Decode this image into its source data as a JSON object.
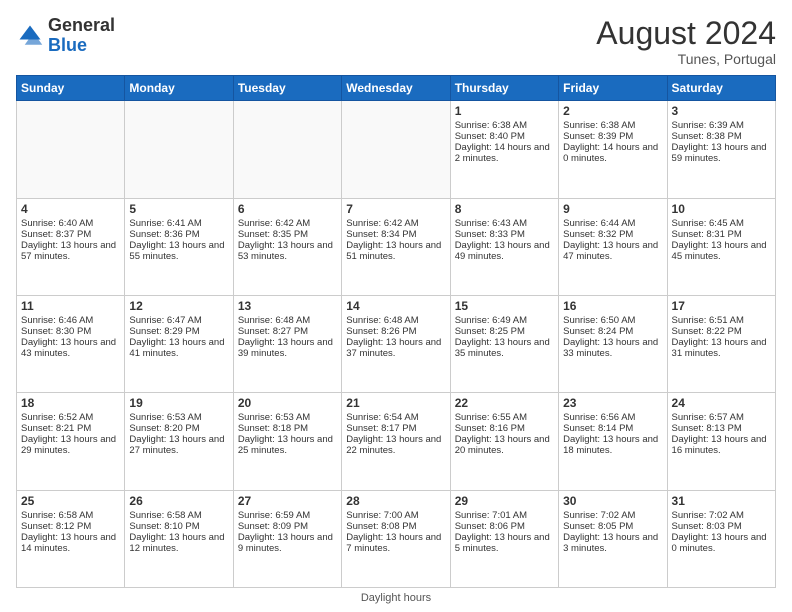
{
  "header": {
    "logo_general": "General",
    "logo_blue": "Blue",
    "month_year": "August 2024",
    "location": "Tunes, Portugal"
  },
  "days_of_week": [
    "Sunday",
    "Monday",
    "Tuesday",
    "Wednesday",
    "Thursday",
    "Friday",
    "Saturday"
  ],
  "weeks": [
    [
      {
        "day": "",
        "info": ""
      },
      {
        "day": "",
        "info": ""
      },
      {
        "day": "",
        "info": ""
      },
      {
        "day": "",
        "info": ""
      },
      {
        "day": "1",
        "info": "Sunrise: 6:38 AM\nSunset: 8:40 PM\nDaylight: 14 hours and 2 minutes."
      },
      {
        "day": "2",
        "info": "Sunrise: 6:38 AM\nSunset: 8:39 PM\nDaylight: 14 hours and 0 minutes."
      },
      {
        "day": "3",
        "info": "Sunrise: 6:39 AM\nSunset: 8:38 PM\nDaylight: 13 hours and 59 minutes."
      }
    ],
    [
      {
        "day": "4",
        "info": "Sunrise: 6:40 AM\nSunset: 8:37 PM\nDaylight: 13 hours and 57 minutes."
      },
      {
        "day": "5",
        "info": "Sunrise: 6:41 AM\nSunset: 8:36 PM\nDaylight: 13 hours and 55 minutes."
      },
      {
        "day": "6",
        "info": "Sunrise: 6:42 AM\nSunset: 8:35 PM\nDaylight: 13 hours and 53 minutes."
      },
      {
        "day": "7",
        "info": "Sunrise: 6:42 AM\nSunset: 8:34 PM\nDaylight: 13 hours and 51 minutes."
      },
      {
        "day": "8",
        "info": "Sunrise: 6:43 AM\nSunset: 8:33 PM\nDaylight: 13 hours and 49 minutes."
      },
      {
        "day": "9",
        "info": "Sunrise: 6:44 AM\nSunset: 8:32 PM\nDaylight: 13 hours and 47 minutes."
      },
      {
        "day": "10",
        "info": "Sunrise: 6:45 AM\nSunset: 8:31 PM\nDaylight: 13 hours and 45 minutes."
      }
    ],
    [
      {
        "day": "11",
        "info": "Sunrise: 6:46 AM\nSunset: 8:30 PM\nDaylight: 13 hours and 43 minutes."
      },
      {
        "day": "12",
        "info": "Sunrise: 6:47 AM\nSunset: 8:29 PM\nDaylight: 13 hours and 41 minutes."
      },
      {
        "day": "13",
        "info": "Sunrise: 6:48 AM\nSunset: 8:27 PM\nDaylight: 13 hours and 39 minutes."
      },
      {
        "day": "14",
        "info": "Sunrise: 6:48 AM\nSunset: 8:26 PM\nDaylight: 13 hours and 37 minutes."
      },
      {
        "day": "15",
        "info": "Sunrise: 6:49 AM\nSunset: 8:25 PM\nDaylight: 13 hours and 35 minutes."
      },
      {
        "day": "16",
        "info": "Sunrise: 6:50 AM\nSunset: 8:24 PM\nDaylight: 13 hours and 33 minutes."
      },
      {
        "day": "17",
        "info": "Sunrise: 6:51 AM\nSunset: 8:22 PM\nDaylight: 13 hours and 31 minutes."
      }
    ],
    [
      {
        "day": "18",
        "info": "Sunrise: 6:52 AM\nSunset: 8:21 PM\nDaylight: 13 hours and 29 minutes."
      },
      {
        "day": "19",
        "info": "Sunrise: 6:53 AM\nSunset: 8:20 PM\nDaylight: 13 hours and 27 minutes."
      },
      {
        "day": "20",
        "info": "Sunrise: 6:53 AM\nSunset: 8:18 PM\nDaylight: 13 hours and 25 minutes."
      },
      {
        "day": "21",
        "info": "Sunrise: 6:54 AM\nSunset: 8:17 PM\nDaylight: 13 hours and 22 minutes."
      },
      {
        "day": "22",
        "info": "Sunrise: 6:55 AM\nSunset: 8:16 PM\nDaylight: 13 hours and 20 minutes."
      },
      {
        "day": "23",
        "info": "Sunrise: 6:56 AM\nSunset: 8:14 PM\nDaylight: 13 hours and 18 minutes."
      },
      {
        "day": "24",
        "info": "Sunrise: 6:57 AM\nSunset: 8:13 PM\nDaylight: 13 hours and 16 minutes."
      }
    ],
    [
      {
        "day": "25",
        "info": "Sunrise: 6:58 AM\nSunset: 8:12 PM\nDaylight: 13 hours and 14 minutes."
      },
      {
        "day": "26",
        "info": "Sunrise: 6:58 AM\nSunset: 8:10 PM\nDaylight: 13 hours and 12 minutes."
      },
      {
        "day": "27",
        "info": "Sunrise: 6:59 AM\nSunset: 8:09 PM\nDaylight: 13 hours and 9 minutes."
      },
      {
        "day": "28",
        "info": "Sunrise: 7:00 AM\nSunset: 8:08 PM\nDaylight: 13 hours and 7 minutes."
      },
      {
        "day": "29",
        "info": "Sunrise: 7:01 AM\nSunset: 8:06 PM\nDaylight: 13 hours and 5 minutes."
      },
      {
        "day": "30",
        "info": "Sunrise: 7:02 AM\nSunset: 8:05 PM\nDaylight: 13 hours and 3 minutes."
      },
      {
        "day": "31",
        "info": "Sunrise: 7:02 AM\nSunset: 8:03 PM\nDaylight: 13 hours and 0 minutes."
      }
    ]
  ],
  "footer": {
    "label": "Daylight hours"
  }
}
